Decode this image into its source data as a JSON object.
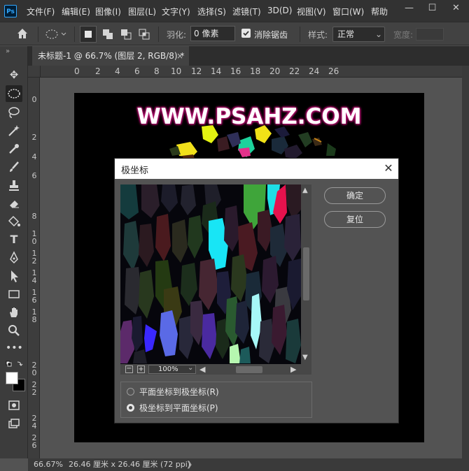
{
  "app": {
    "logo": "Ps"
  },
  "menu": {
    "items": [
      "文件(F)",
      "编辑(E)",
      "图像(I)",
      "图层(L)",
      "文字(Y)",
      "选择(S)",
      "滤镜(T)",
      "3D(D)",
      "视图(V)",
      "窗口(W)",
      "帮助"
    ]
  },
  "window_controls": {
    "minimize": "—",
    "restore": "☐",
    "close": "✕"
  },
  "options": {
    "feather_label": "羽化:",
    "feather_value": "0 像素",
    "antialias_label": "消除锯齿",
    "antialias_checked": true,
    "style_label": "样式:",
    "style_value": "正常",
    "width_label": "宽度:"
  },
  "tab": {
    "title": "未标题-1 @ 66.7% (图层 2, RGB/8) *",
    "close": "×"
  },
  "ruler_top": [
    "0",
    "2",
    "4",
    "6",
    "8",
    "10",
    "12",
    "14",
    "16",
    "18",
    "20",
    "22",
    "24",
    "26"
  ],
  "ruler_left": [
    "0",
    "2",
    "4",
    "6",
    "8",
    "1\n0",
    "1\n2",
    "1\n4",
    "1\n6",
    "1\n8",
    "2\n0",
    "2\n2",
    "2\n4",
    "2\n6"
  ],
  "canvas": {
    "watermark": "WWW.PSAHZ.COM"
  },
  "status": {
    "zoom": "66.67%",
    "doc_info": "26.46 厘米 x 26.46 厘米 (72 ppi)",
    "arrow": "❯"
  },
  "dialog": {
    "title": "极坐标",
    "close": "✕",
    "ok_label": "确定",
    "reset_label": "复位",
    "zoom_value": "100%",
    "zoom_out": "−",
    "zoom_in": "+",
    "options": [
      {
        "label": "平面坐标到极坐标(R)",
        "selected": false
      },
      {
        "label": "极坐标到平面坐标(P)",
        "selected": true
      }
    ]
  },
  "colors": {
    "accent": "#31a8ff",
    "watermark_glow": "#b3126f"
  }
}
